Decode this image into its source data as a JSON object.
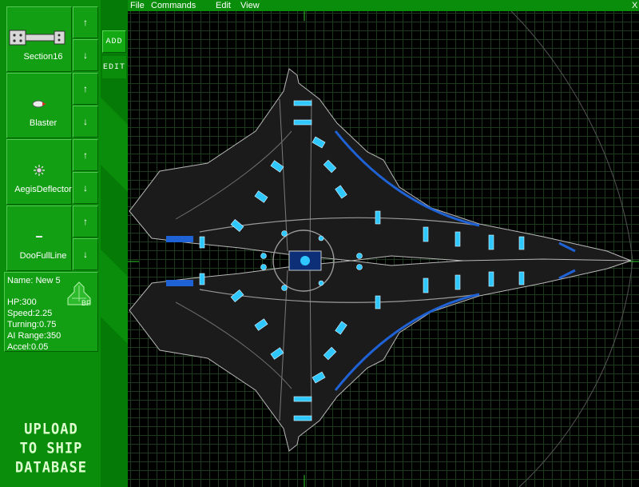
{
  "menubar": {
    "file": "File",
    "commands": "Commands",
    "edit": "Edit",
    "view": "View",
    "close": "X"
  },
  "tabs": {
    "add": "ADD",
    "edit": "EDIT"
  },
  "parts": [
    {
      "label": "Section16",
      "icon": "section-icon"
    },
    {
      "label": "Blaster",
      "icon": "blaster-icon"
    },
    {
      "label": "AegisDeflector",
      "icon": "deflector-icon"
    },
    {
      "label": "DooFullLine",
      "icon": "line-icon"
    }
  ],
  "arrows": {
    "up": "↑",
    "down": "↓"
  },
  "ship": {
    "name": "Name: New 5",
    "hp": "HP:300",
    "speed": "Speed:2.25",
    "turning": "Turning:0.75",
    "ai_range": "AI Range:350",
    "accel": "Accel:0.05",
    "logo_text": "BP"
  },
  "upload": {
    "line1": "UPLOAD",
    "line2": "TO SHIP",
    "line3": "DATABASE"
  },
  "colors": {
    "panel": "#0a8d0a",
    "cell": "#139f13",
    "grid": "#1e3a1e",
    "hull_glow": "#2ec8ff"
  }
}
